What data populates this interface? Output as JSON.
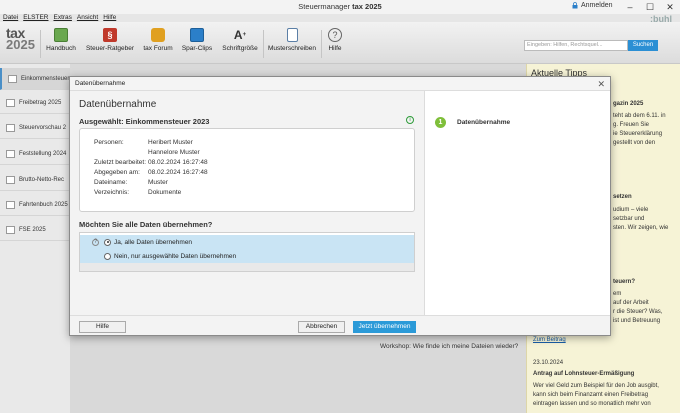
{
  "window": {
    "title_prefix": "Steuermanager",
    "title_bold": "tax 2025",
    "signin": "Anmelden",
    "brand": "buhl"
  },
  "menu": [
    "Datei",
    "ELSTER",
    "Extras",
    "Ansicht",
    "Hilfe"
  ],
  "logo": {
    "line1": "tax",
    "line2": "2025"
  },
  "toolbar": [
    {
      "label": "Handbuch",
      "icon": "book-icon",
      "color": "#6aa84f"
    },
    {
      "label": "Steuer-Ratgeber",
      "icon": "paragraph-book-icon",
      "color": "#c0392b"
    },
    {
      "label": "tax Forum",
      "icon": "forum-icon",
      "color": "#e0a020"
    },
    {
      "label": "Spar-Clips",
      "icon": "video-icon",
      "color": "#2b7fc9"
    },
    {
      "label": "Schriftgröße",
      "icon": "font-size-icon",
      "color": "#444444"
    },
    {
      "label": "Musterschreiben",
      "icon": "document-icon",
      "color": "#5b7fa6"
    },
    {
      "label": "Hilfe",
      "icon": "help-icon",
      "color": "#666666"
    }
  ],
  "search": {
    "placeholder": "Eingeben: Hilfen, Rechtsquel...",
    "button": "Suchen"
  },
  "sidebar": [
    {
      "label": "Einkommensteuer",
      "active": true
    },
    {
      "label": "Freibetrag 2025",
      "active": false
    },
    {
      "label": "Steuervorschau 2",
      "active": false
    },
    {
      "label": "Feststellung 2024",
      "active": false
    },
    {
      "label": "Brutto-Netto-Rec",
      "active": false
    },
    {
      "label": "Fahrtenbuch 2025",
      "active": false
    },
    {
      "label": "FSE 2025",
      "active": false
    }
  ],
  "tips": {
    "title": "Aktuelle Tipps",
    "lines": [
      {
        "text": "gazin 2025",
        "cls": "rp-h"
      },
      {
        "text": "teht ab dem 6.11. in",
        "cls": ""
      },
      {
        "text": "g. Freuen Sie",
        "cls": ""
      },
      {
        "text": "ie Steuererklärung",
        "cls": ""
      },
      {
        "text": "gestellt von den",
        "cls": ""
      },
      {
        "text": "setzen",
        "cls": "rp-h"
      },
      {
        "text": "udium – viele",
        "cls": ""
      },
      {
        "text": "setzbar und",
        "cls": ""
      },
      {
        "text": "sten. Wir zeigen, wie",
        "cls": ""
      },
      {
        "text": "teuern?",
        "cls": "rp-h"
      },
      {
        "text": "em",
        "cls": ""
      },
      {
        "text": "auf der Arbeit",
        "cls": ""
      },
      {
        "text": "r die Steuer? Was,",
        "cls": ""
      },
      {
        "text": "ist und Betreuung",
        "cls": ""
      }
    ],
    "link": "Zum Beitrag",
    "date": "23.10.2024",
    "heading": "Antrag auf Lohnsteuer-Ermäßigung",
    "body": [
      "Wer viel Geld zum Beispiel für den Job ausgibt,",
      "kann sich beim Finanzamt einen Freibetrag",
      "eintragen lassen und so monatlich mehr von"
    ]
  },
  "workshop": "Workshop: Wie finde ich meine Dateien wieder?",
  "dialog": {
    "title": "Datenübernahme",
    "heading": "Datenübernahme",
    "selected": "Ausgewählt: Einkommensteuer 2023",
    "info": [
      {
        "key": "Personen:",
        "value": "Heribert Muster"
      },
      {
        "key": "",
        "value": "Hannelore Muster"
      },
      {
        "key": "Zuletzt bearbeitet:",
        "value": "08.02.2024 16:27:48"
      },
      {
        "key": "Abgegeben am:",
        "value": "08.02.2024 16:27:48"
      },
      {
        "key": "Dateiname:",
        "value": "Muster"
      },
      {
        "key": "Verzeichnis:",
        "value": "Dokumente"
      }
    ],
    "question": "Möchten Sie alle Daten übernehmen?",
    "options": [
      {
        "label": "Ja, alle Daten übernehmen",
        "selected": true
      },
      {
        "label": "Nein, nur ausgewählte Daten übernehmen",
        "selected": false
      }
    ],
    "step": {
      "number": "1",
      "label": "Datenübernahme"
    },
    "buttons": {
      "help": "Hilfe",
      "cancel": "Abbrechen",
      "confirm": "Jetzt übernehmen"
    }
  }
}
